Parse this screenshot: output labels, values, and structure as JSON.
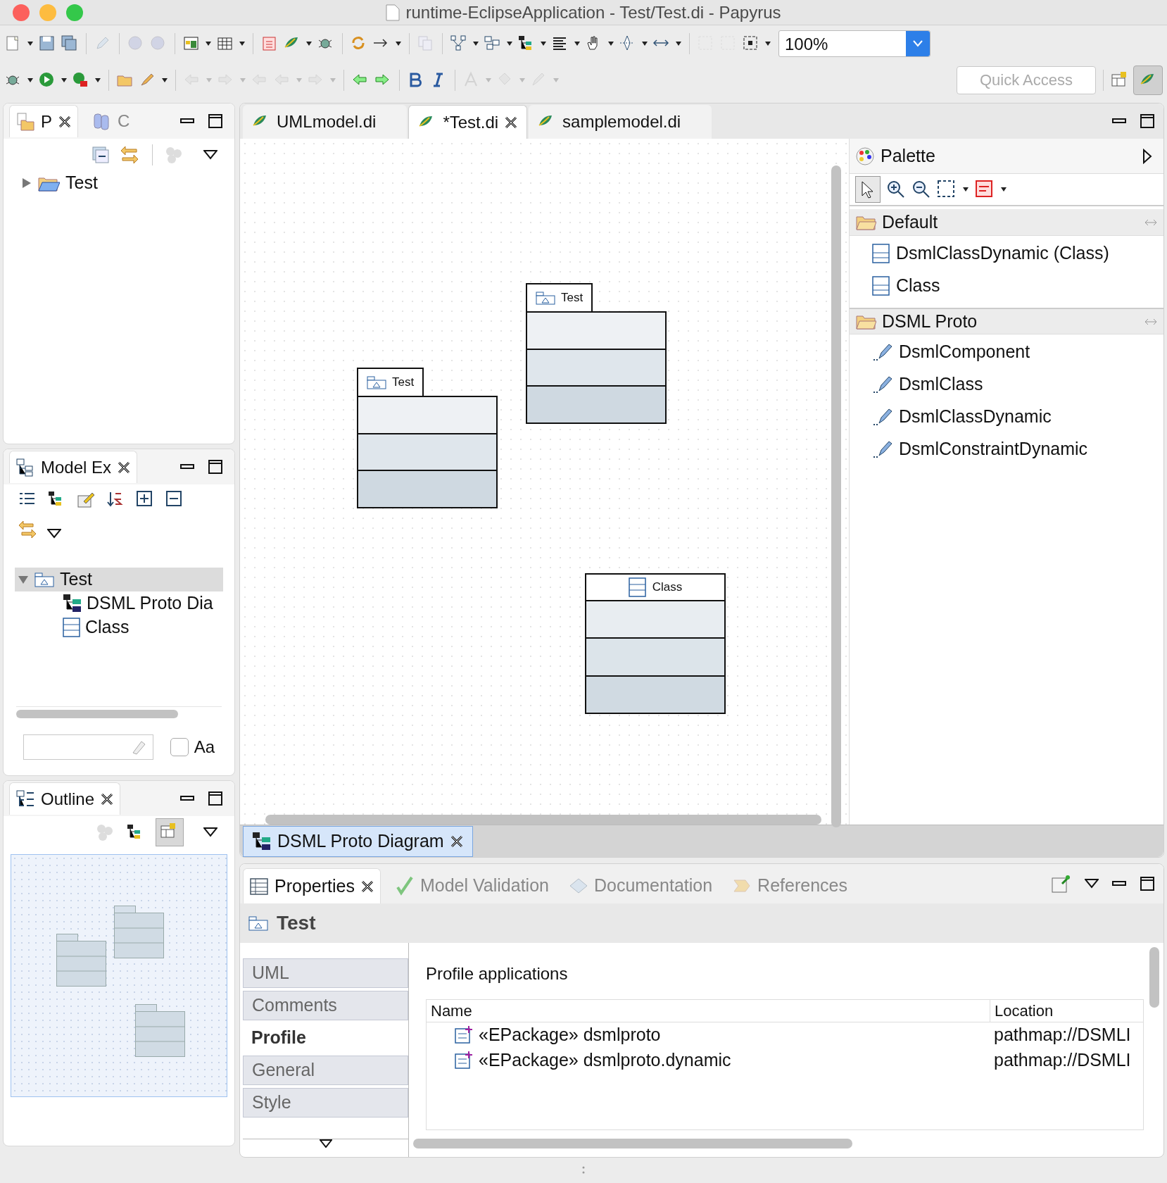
{
  "window": {
    "title": "runtime-EclipseApplication - Test/Test.di - Papyrus"
  },
  "toolbar": {
    "zoom": "100%",
    "quick_access": {
      "placeholder": "Quick Access"
    }
  },
  "project_explorer": {
    "tabs": [
      {
        "label": "P",
        "selected": true
      },
      {
        "label": "C",
        "selected": false
      }
    ],
    "tree": [
      {
        "label": "Test",
        "expanded": false
      }
    ]
  },
  "model_explorer": {
    "title": "Model Ex",
    "tree": [
      {
        "label": "Test",
        "selected": true,
        "expanded": true,
        "children": [
          {
            "label": "DSML Proto Dia",
            "kind": "diagram"
          },
          {
            "label": "Class",
            "kind": "class"
          }
        ]
      }
    ],
    "case_option": {
      "label": "Aa",
      "checked": false
    }
  },
  "outline": {
    "title": "Outline"
  },
  "editor_tabs": [
    {
      "label": "UMLmodel.di",
      "selected": false
    },
    {
      "label": "*Test.di",
      "selected": true
    },
    {
      "label": "samplemodel.di",
      "selected": false
    }
  ],
  "diagram": {
    "nodes": [
      {
        "kind": "package",
        "label": "Test"
      },
      {
        "kind": "package",
        "label": "Test"
      },
      {
        "kind": "class",
        "label": "Class"
      }
    ]
  },
  "palette": {
    "title": "Palette",
    "drawers": [
      {
        "label": "Default",
        "items": [
          {
            "label": "DsmlClassDynamic (Class)",
            "kind": "class"
          },
          {
            "label": "Class",
            "kind": "class"
          }
        ]
      },
      {
        "label": "DSML Proto",
        "items": [
          {
            "label": "DsmlComponent",
            "kind": "tool"
          },
          {
            "label": "DsmlClass",
            "kind": "tool"
          },
          {
            "label": "DsmlClassDynamic",
            "kind": "tool"
          },
          {
            "label": "DsmlConstraintDynamic",
            "kind": "tool"
          }
        ]
      }
    ]
  },
  "diagram_tab": {
    "label": "DSML Proto Diagram"
  },
  "properties": {
    "tabs": [
      {
        "label": "Properties",
        "selected": true
      },
      {
        "label": "Model Validation",
        "selected": false
      },
      {
        "label": "Documentation",
        "selected": false
      },
      {
        "label": "References",
        "selected": false
      }
    ],
    "header": "Test",
    "sections": [
      {
        "label": "UML",
        "selected": false
      },
      {
        "label": "Comments",
        "selected": false
      },
      {
        "label": "Profile",
        "selected": true
      },
      {
        "label": "General",
        "selected": false
      },
      {
        "label": "Style",
        "selected": false
      }
    ],
    "section_title": "Profile applications",
    "table": {
      "columns": [
        "Name",
        "Location"
      ],
      "rows": [
        [
          "«EPackage» dsmlproto",
          "pathmap://DSMLI"
        ],
        [
          "«EPackage» dsmlproto.dynamic",
          "pathmap://DSMLI"
        ]
      ]
    }
  }
}
